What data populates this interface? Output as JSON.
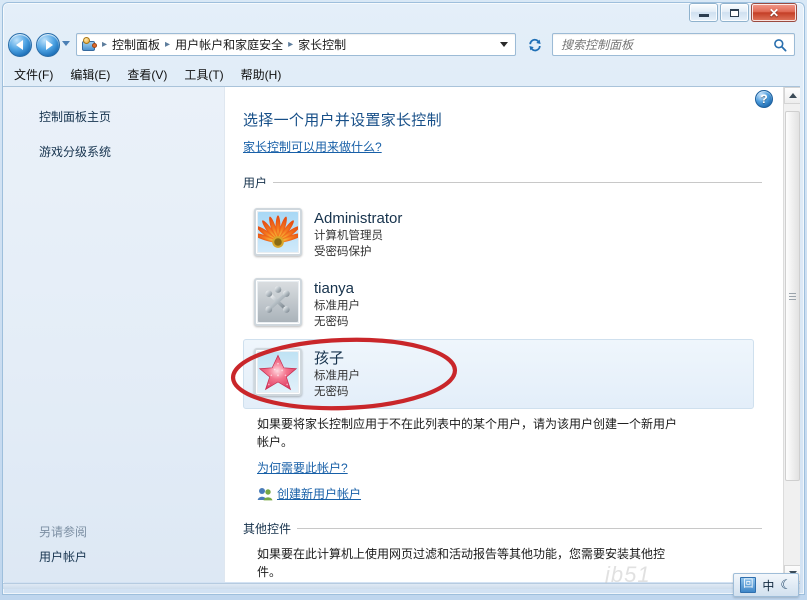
{
  "window": {
    "minimize_label": "–",
    "maximize_label": "□",
    "close_label": "✕"
  },
  "navbar": {
    "back_label": "后退",
    "forward_label": "前进",
    "recent_label": "最近浏览的位置",
    "address_icon": "control-panel-icon",
    "breadcrumbs": [
      "控制面板",
      "用户帐户和家庭安全",
      "家长控制"
    ],
    "separator": "▸",
    "refresh_label": "刷新"
  },
  "search": {
    "placeholder": "搜索控制面板",
    "value": "",
    "icon": "search-icon"
  },
  "menubar": {
    "items": [
      {
        "label": "文件(F)"
      },
      {
        "label": "编辑(E)"
      },
      {
        "label": "查看(V)"
      },
      {
        "label": "工具(T)"
      },
      {
        "label": "帮助(H)"
      }
    ]
  },
  "sidebar": {
    "top_links": [
      {
        "label": "控制面板主页"
      },
      {
        "label": "游戏分级系统"
      }
    ],
    "see_also_heading": "另请参阅",
    "see_also_links": [
      {
        "label": "用户帐户"
      }
    ]
  },
  "main": {
    "help_label": "?",
    "page_title": "选择一个用户并设置家长控制",
    "intro_link": "家长控制可以用来做什么?",
    "users_section_label": "用户",
    "users": [
      {
        "name": "Administrator",
        "role": "计算机管理员",
        "password": "受密码保护",
        "avatar": "flower-avatar",
        "selected": false
      },
      {
        "name": "tianya",
        "role": "标准用户",
        "password": "无密码",
        "avatar": "jacks-avatar",
        "selected": false
      },
      {
        "name": "孩子",
        "role": "标准用户",
        "password": "无密码",
        "avatar": "starfish-avatar",
        "selected": true
      }
    ],
    "note_text": "如果要将家长控制应用于不在此列表中的某个用户，请为该用户创建一个新用户帐户。",
    "why_link": "为何需要此帐户?",
    "create_account_link": "创建新用户帐户",
    "create_account_icon": "users-icon",
    "other_section_label": "其他控件",
    "other_text": "如果要在此计算机上使用网页过滤和活动报告等其他功能，您需要安装其他控件。"
  },
  "annotation": {
    "shape": "ellipse",
    "color": "#c9262a",
    "target": "孩子"
  },
  "scrollbar": {
    "up_label": "向上滚动",
    "down_label": "向下滚动",
    "thumb_label": "滚动条滑块"
  },
  "watermark": {
    "text": "jb51"
  },
  "ime": {
    "icon": "ime-mode-icon",
    "mode": "中",
    "moon": "☾"
  },
  "colors": {
    "accent": "#1860a8",
    "title": "#174f88",
    "annotation": "#c9262a",
    "close": "#c43f27"
  }
}
